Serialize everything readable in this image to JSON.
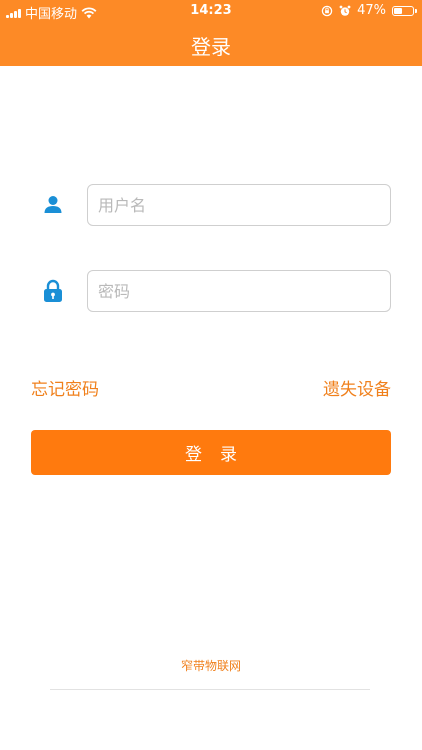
{
  "status_bar": {
    "carrier": "中国移动",
    "time": "14:23",
    "battery": "47%",
    "battery_level": 0.47
  },
  "header": {
    "title": "登录"
  },
  "form": {
    "username_placeholder": "用户名",
    "password_placeholder": "密码"
  },
  "links": {
    "forgot_password": "忘记密码",
    "lost_device": "遗失设备"
  },
  "login_button": "登录",
  "footer": {
    "brand": "窄带物联网"
  },
  "colors": {
    "header": "#fd8a26",
    "accent": "#f0801c",
    "button": "#ff7a0e",
    "icon": "#1a8fd6"
  }
}
